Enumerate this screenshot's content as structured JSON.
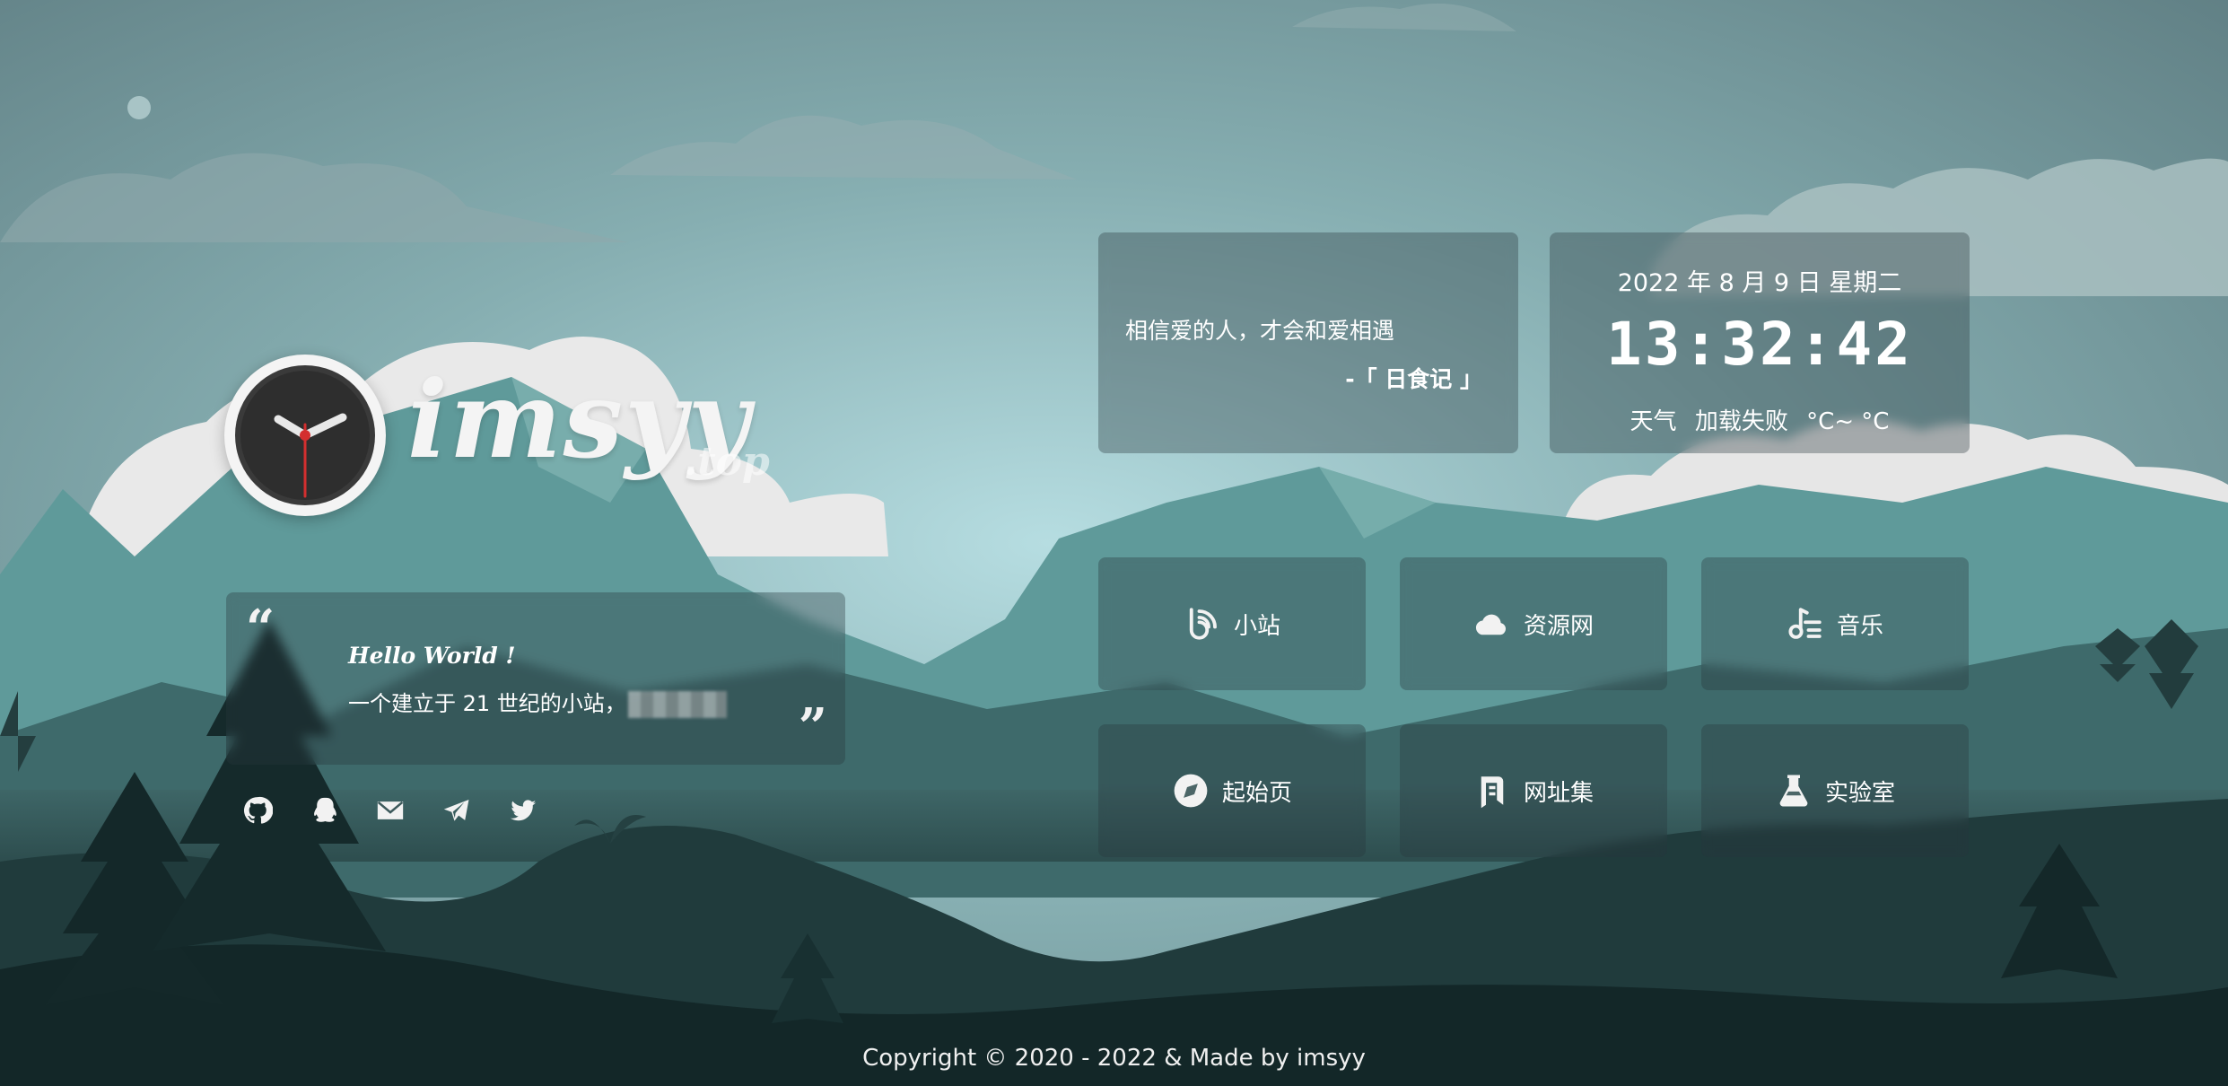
{
  "brand": {
    "name": "imsyy",
    "suffix": ".top"
  },
  "hello": {
    "title": "Hello World !",
    "description": "一个建立于 21 世纪的小站，"
  },
  "social": [
    {
      "name": "github-icon"
    },
    {
      "name": "qq-icon"
    },
    {
      "name": "email-icon"
    },
    {
      "name": "telegram-icon"
    },
    {
      "name": "twitter-icon"
    }
  ],
  "hitokoto": {
    "text": "相信爱的人，才会和爱相遇",
    "from": "-「 日食记 」"
  },
  "time": {
    "date": "2022 年 8 月 9 日 星期二",
    "clock": "13:32:42",
    "weather_label": "天气",
    "weather_status": "加载失败",
    "temperature": "°C~ °C"
  },
  "nav": [
    {
      "label": "小站",
      "icon": "blog-icon"
    },
    {
      "label": "资源网",
      "icon": "cloud-icon"
    },
    {
      "label": "音乐",
      "icon": "music-icon"
    },
    {
      "label": "起始页",
      "icon": "compass-icon"
    },
    {
      "label": "网址集",
      "icon": "bookmark-icon"
    },
    {
      "label": "实验室",
      "icon": "flask-icon"
    }
  ],
  "footer": {
    "copyright": "Copyright © 2020 - 2022  &  Made by imsyy"
  },
  "colors": {
    "sky_top": "#6c8d92",
    "sky_glow": "#b6dde1",
    "mountain_far": "#5f9a9a",
    "hill_dark": "#1c3334",
    "card_bg": "rgba(40,55,60,0.35)"
  }
}
